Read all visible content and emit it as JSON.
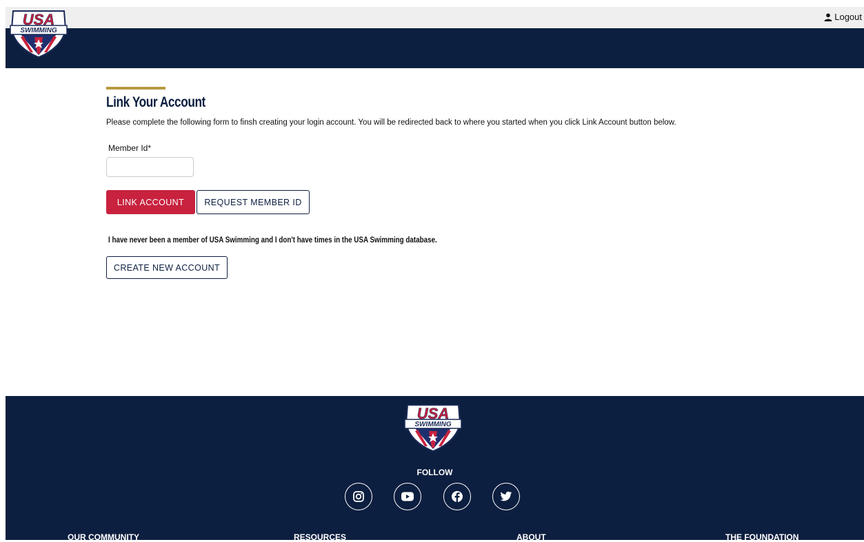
{
  "header": {
    "logo_alt": "USA Swimming",
    "logout_label": "Logout",
    "logout_icon": "user-icon"
  },
  "main": {
    "title": "Link Your Account",
    "instructions": "Please complete the following form to finsh creating your login account. You will be redirected back to where you started when you click Link Account button below.",
    "member_id_label": "Member Id*",
    "member_id_value": "",
    "link_account_button": "LINK ACCOUNT",
    "request_member_id_button": "REQUEST MEMBER ID",
    "never_member_text": "I have never been a member of USA Swimming and I don't have times in the USA Swimming database.",
    "create_new_account_button": "CREATE NEW ACCOUNT"
  },
  "footer": {
    "follow_label": "FOLLOW",
    "social": [
      "instagram-icon",
      "youtube-icon",
      "facebook-icon",
      "twitter-icon"
    ],
    "columns": [
      "OUR COMMUNITY",
      "RESOURCES",
      "ABOUT",
      "THE FOUNDATION"
    ]
  },
  "colors": {
    "navy": "#0d1f40",
    "brand_red": "#c8223e",
    "accent_gold": "#b59a3f",
    "topbar_gray": "#efefef"
  }
}
